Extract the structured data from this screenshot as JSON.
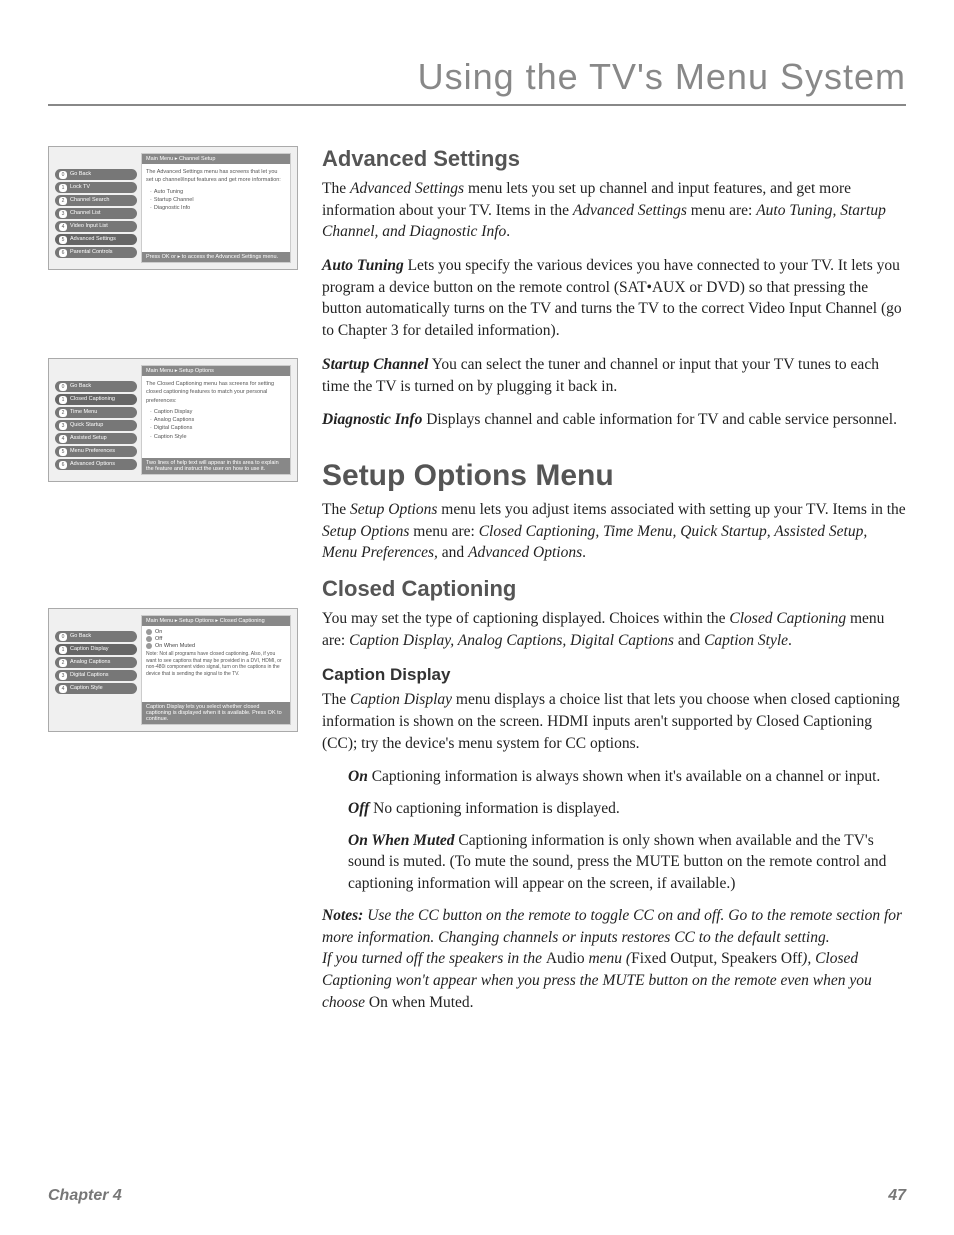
{
  "page_title": "Using the TV's Menu System",
  "footer": {
    "chapter": "Chapter 4",
    "page": "47"
  },
  "shot1": {
    "crumb": "Main Menu ▸ Channel Setup",
    "desc": "The Advanced Settings menu has screens that let you set up channel/input features and get more information:",
    "items": [
      "Auto Tuning",
      "Startup Channel",
      "Diagnostic Info"
    ],
    "foot": "Press OK or ▸ to access the Advanced Settings menu.",
    "menu": [
      "Go Back",
      "Lock TV",
      "Channel Search",
      "Channel List",
      "Video Input List",
      "Advanced Settings",
      "Parental Controls"
    ]
  },
  "shot2": {
    "crumb": "Main Menu ▸ Setup Options",
    "desc": "The Closed Captioning menu has screens for setting closed captioning features to match your personal preferences:",
    "items": [
      "Caption Display",
      "Analog Captions",
      "Digital Captions",
      "Caption Style"
    ],
    "foot": "Two lines of help text will appear in this area to explain the feature and instruct the user on how to use it.",
    "menu": [
      "Go Back",
      "Closed Captioning",
      "Time Menu",
      "Quick Startup",
      "Assisted Setup",
      "Menu Preferences",
      "Advanced Options"
    ]
  },
  "shot3": {
    "crumb": "Main Menu ▸ Setup Options ▸ Closed Captioning",
    "radios": [
      "On",
      "Off",
      "On When Muted"
    ],
    "note": "Note: Not all programs have closed captioning. Also, if you want to see captions that may be provided in a DVI, HDMI, or non-480i component video signal, turn on the captions in the device that is sending the signal to the TV.",
    "foot": "Caption Display lets you select whether closed captioning is displayed when it is available. Press OK to continue.",
    "menu": [
      "Go Back",
      "Caption Display",
      "Analog Captions",
      "Digital Captions",
      "Caption Style"
    ]
  },
  "advanced": {
    "h": "Advanced Settings",
    "p1a": "The ",
    "p1b": "Advanced Settings",
    "p1c": " menu lets you set up channel and input features, and get more information about your TV. Items in the ",
    "p1d": "Advanced Settings",
    "p1e": " menu are: ",
    "p1f": "Auto Tuning, Startup Channel, and Diagnostic Info",
    "p1g": ".",
    "auto_t": "Auto Tuning",
    "auto_b": "   Lets you specify the various devices you have connected to your TV. It lets you program a device button on the remote control (SAT•AUX or DVD) so that pressing the button automatically turns on the TV and turns the TV to the correct Video Input Channel (go to Chapter 3 for detailed information).",
    "start_t": "Startup Channel",
    "start_b": "   You can select the tuner and channel or input that your TV tunes to each time the TV is turned on by plugging it back in.",
    "diag_t": "Diagnostic Info",
    "diag_b": "   Displays channel and cable information for TV and cable service personnel."
  },
  "setup": {
    "h": "Setup Options Menu",
    "p1a": "The ",
    "p1b": "Setup Options",
    "p1c": " menu lets you adjust items associated with setting up your TV. Items in the ",
    "p1d": "Setup Options",
    "p1e": " menu are: ",
    "p1f": "Closed Captioning, Time Menu, Quick Startup, Assisted Setup, Menu Preferences,",
    "p1g": " and ",
    "p1h": "Advanced Options",
    "p1i": "."
  },
  "cc": {
    "h": "Closed Captioning",
    "p1a": "You may set the type of captioning displayed. Choices within the ",
    "p1b": "Closed Captioning",
    "p1c": " menu are: ",
    "p1d": "Caption Display, Analog Captions, Digital Captions",
    "p1e": " and ",
    "p1f": "Caption Style",
    "p1g": "."
  },
  "cd": {
    "h": "Caption Display",
    "p1a": "The ",
    "p1b": "Caption Display",
    "p1c": " menu displays a choice list that lets you choose when closed captioning information is shown on the screen. HDMI inputs aren't supported by Closed Captioning (CC); try the device's menu system for CC options.",
    "on_t": "On",
    "on_b": "     Captioning information is always shown when it's available on a channel or input.",
    "off_t": "Off",
    "off_b": "     No captioning information is displayed.",
    "mut_t": "On When Muted",
    "mut_b": "     Captioning information is only shown when available and the TV's sound is muted. (To mute the sound, press the MUTE button on the remote control and captioning information will appear on the screen, if available.)",
    "notes_lead": "Notes:",
    "notes1": " Use the CC button on the remote to toggle CC on and off. Go to the remote section for more information. Changing channels or inputs restores CC to the default setting.",
    "notes2a": "If you turned off the speakers in the ",
    "notes2b": "Audio",
    "notes2c": " menu (",
    "notes2d": "Fixed Output, Speakers Off",
    "notes2e": "), Closed Captioning won't appear when you press the MUTE button on the remote even when you choose ",
    "notes2f": "On when Muted."
  }
}
